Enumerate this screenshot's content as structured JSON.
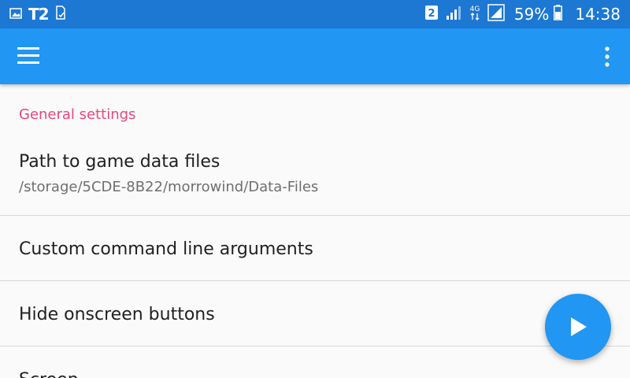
{
  "status_bar": {
    "carrier": "T2",
    "sim_slot": "2",
    "network_type": "4G",
    "battery_percent": "59%",
    "time": "14:38",
    "icons": [
      "image-notification-icon",
      "sim-icon",
      "signal-icon",
      "data-arrows-icon",
      "battery-icon"
    ]
  },
  "app_bar": {
    "menu_icon": "hamburger-menu-icon",
    "overflow_icon": "more-vert-icon",
    "color": "#2196f3"
  },
  "settings": {
    "section_header": "General settings",
    "items": [
      {
        "title": "Path to game data files",
        "summary": "/storage/5CDE-8B22/morrowind/Data-Files"
      },
      {
        "title": "Custom command line arguments"
      },
      {
        "title": "Hide onscreen buttons"
      },
      {
        "title": "Screen"
      }
    ]
  },
  "fab": {
    "icon": "play-icon",
    "color": "#2196f3"
  },
  "accent_color": "#e8477f"
}
